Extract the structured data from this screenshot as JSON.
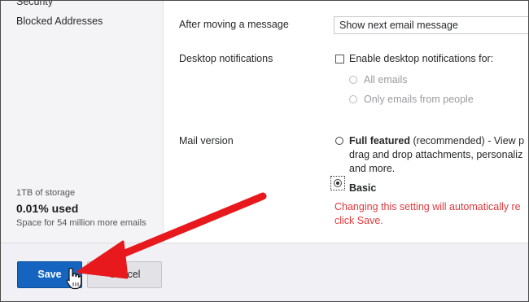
{
  "sidebar": {
    "security_label": "Security",
    "blocked_label": "Blocked Addresses",
    "storage": {
      "plan": "1TB of storage",
      "used": "0.01% used",
      "space": "Space for 54 million more emails"
    }
  },
  "settings": {
    "after_moving": {
      "label": "After moving a message",
      "selected_value": "Show next email message"
    },
    "desktop_notifications": {
      "label": "Desktop notifications",
      "checkbox_label": "Enable desktop notifications for:",
      "options": [
        "All emails",
        "Only emails from people"
      ]
    },
    "mail_version": {
      "label": "Mail version",
      "full_featured": {
        "title": "Full featured",
        "line1_rest": " (recommended) - View p",
        "line2": "drag and drop attachments, personaliz",
        "line3": "and more."
      },
      "basic": {
        "title": "Basic",
        "selected": true
      },
      "warning_line1": "Changing this setting will automatically re",
      "warning_line2": "click Save."
    }
  },
  "footer": {
    "save_label": "Save",
    "cancel_label": "Cancel"
  },
  "colors": {
    "save_button": "#1565c0",
    "warning_text": "#e0393c",
    "annotation_arrow": "#e8191c"
  },
  "icons": {
    "cursor": "hand-pointer-icon",
    "annotation": "red-arrow-annotation"
  }
}
